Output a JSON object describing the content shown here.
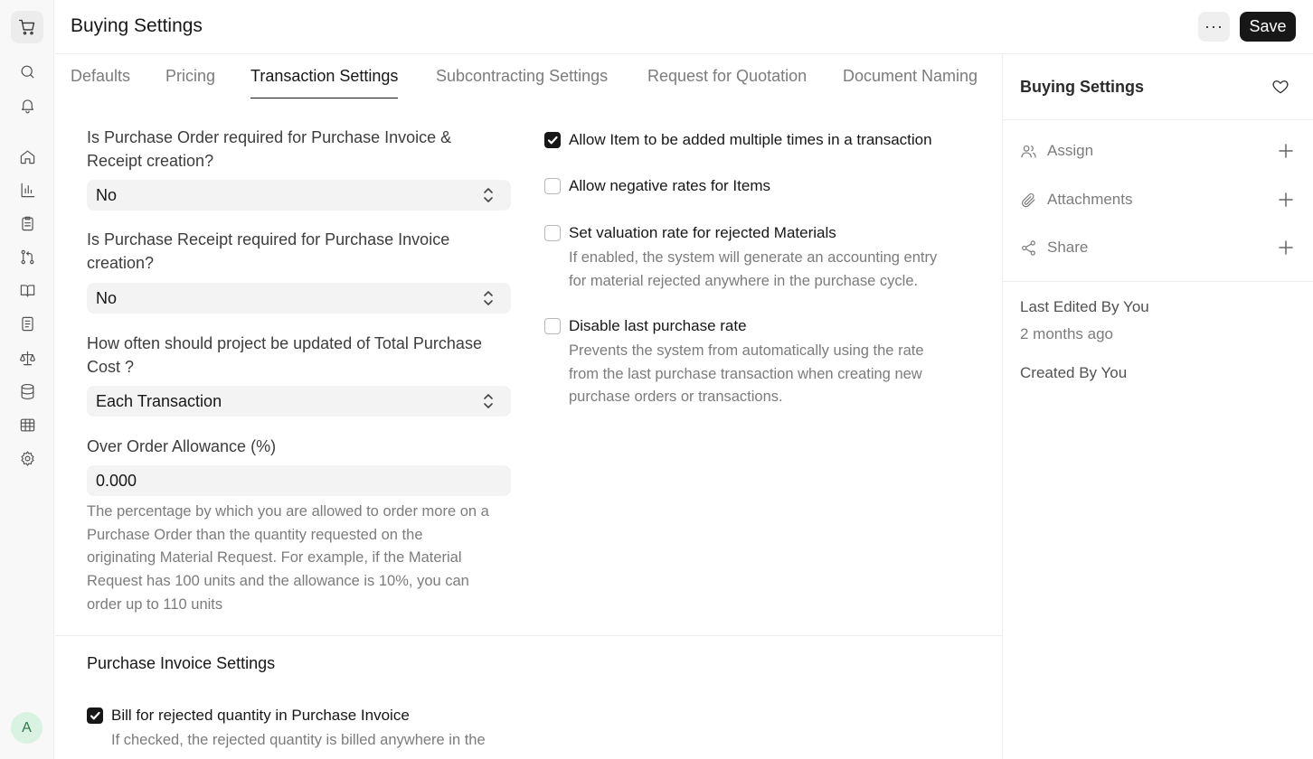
{
  "header": {
    "title": "Buying Settings",
    "more_label": "···",
    "save_label": "Save"
  },
  "rail": {
    "avatar_initial": "A",
    "icons": [
      "cart-icon",
      "search-icon",
      "bell-icon",
      "home-icon",
      "bar-chart-icon",
      "clipboard-icon",
      "git-branch-icon",
      "book-icon",
      "file-text-icon",
      "scale-icon",
      "database-icon",
      "table-icon",
      "gear-icon"
    ]
  },
  "tabs": [
    {
      "label": "Defaults",
      "active": false
    },
    {
      "label": "Pricing",
      "active": false
    },
    {
      "label": "Transaction Settings",
      "active": true
    },
    {
      "label": "Subcontracting Settings",
      "active": false
    },
    {
      "label": "Request for Quotation",
      "active": false
    },
    {
      "label": "Document Naming",
      "active": false
    }
  ],
  "left_fields": {
    "po_required": {
      "label_line1": "Is Purchase Order required for Purchase Invoice &",
      "label_line2": "Receipt creation?",
      "value": "No"
    },
    "pr_required": {
      "label_line1": "Is Purchase Receipt required for Purchase Invoice",
      "label_line2": "creation?",
      "value": "No"
    },
    "project_update": {
      "label_line1": "How often should project be updated of Total Purchase",
      "label_line2": "Cost ?",
      "value": "Each Transaction"
    },
    "over_order": {
      "label": "Over Order Allowance (%)",
      "value": "0.000",
      "help_lines": [
        "The percentage by which you are allowed to order more on a",
        "Purchase Order than the quantity requested on the",
        "originating Material Request. For example, if the Material",
        "Request has 100 units and the allowance is 10%, you can",
        "order up to 110 units"
      ]
    }
  },
  "checkboxes": {
    "allow_multiple": {
      "label": "Allow Item to be added multiple times in a transaction",
      "checked": true
    },
    "allow_negative": {
      "label": "Allow negative rates for Items",
      "checked": false
    },
    "valuation_rejected": {
      "label": "Set valuation rate for rejected Materials",
      "checked": false,
      "help_lines": [
        "If enabled, the system will generate an accounting entry",
        "for material rejected anywhere in the purchase cycle."
      ]
    },
    "disable_last_rate": {
      "label": "Disable last purchase rate",
      "checked": false,
      "help_lines": [
        "Prevents the system from automatically using the rate",
        "from the last purchase transaction when creating new",
        "purchase orders or transactions."
      ]
    }
  },
  "purchase_invoice_section": {
    "title": "Purchase Invoice Settings",
    "bill_rejected": {
      "label": "Bill for rejected quantity in Purchase Invoice",
      "checked": true,
      "help_line1": "If checked, the rejected quantity is billed anywhere in the"
    }
  },
  "sidebar": {
    "title": "Buying Settings",
    "assign_label": "Assign",
    "attachments_label": "Attachments",
    "share_label": "Share",
    "last_edited": "Last Edited By You",
    "last_edited_time": "2 months ago",
    "created_by": "Created By You"
  }
}
